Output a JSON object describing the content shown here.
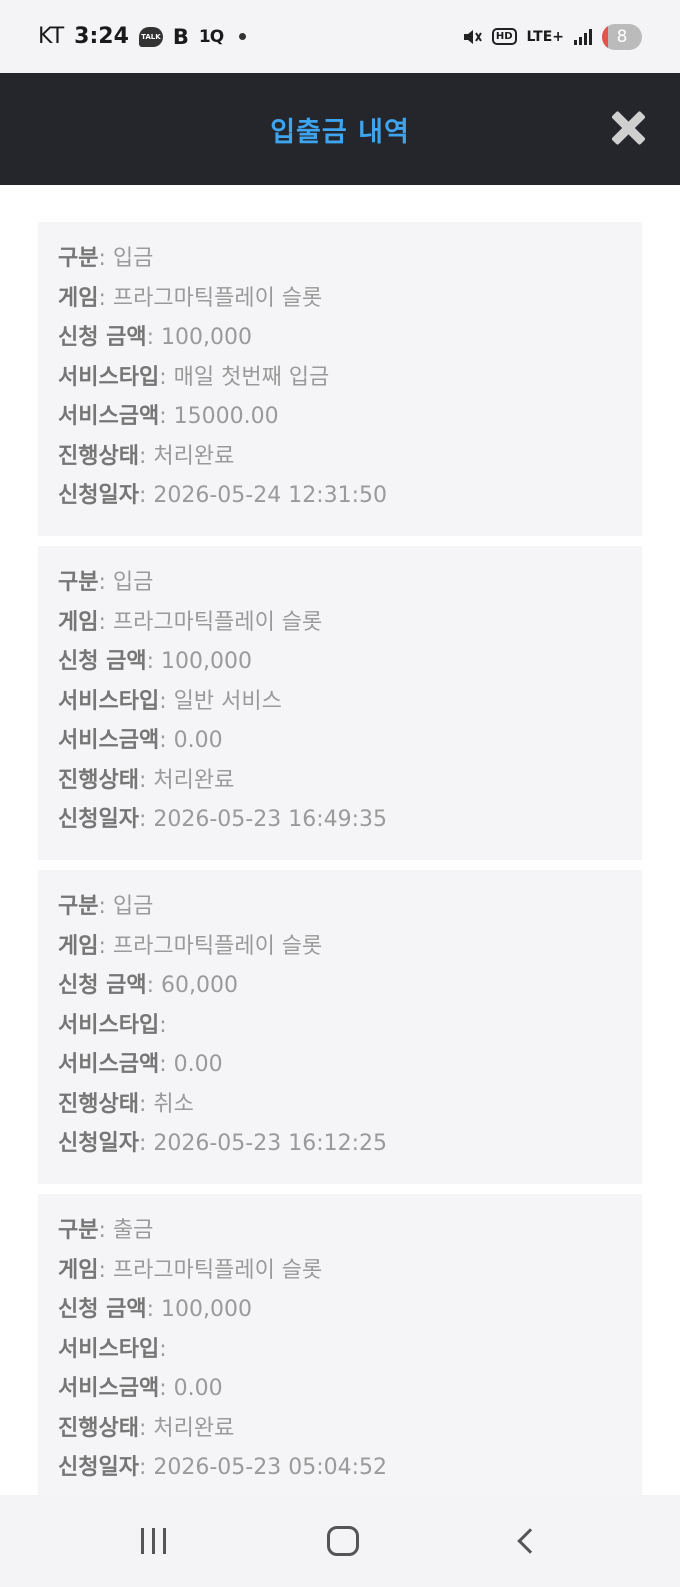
{
  "status_bar": {
    "carrier": "KT",
    "time": "3:24",
    "talk_label": "TALK",
    "b_label": "B",
    "q_label": "1Q",
    "hd_label": "HD",
    "network_label": "LTE+",
    "battery_level": "8"
  },
  "header": {
    "title": "입출금 내역"
  },
  "field_labels": {
    "type": "구분",
    "game": "게임",
    "amount": "신청 금액",
    "service_type": "서비스타입",
    "service_amount": "서비스금액",
    "status": "진행상태",
    "date": "신청일자"
  },
  "transactions": [
    {
      "type": "입금",
      "game": "프라그마틱플레이 슬롯",
      "amount": "100,000",
      "service_type": "매일 첫번째 입금",
      "service_amount": "15000.00",
      "status": "처리완료",
      "date": "2026-05-24 12:31:50"
    },
    {
      "type": "입금",
      "game": "프라그마틱플레이 슬롯",
      "amount": "100,000",
      "service_type": "일반 서비스",
      "service_amount": "0.00",
      "status": "처리완료",
      "date": "2026-05-23 16:49:35"
    },
    {
      "type": "입금",
      "game": "프라그마틱플레이 슬롯",
      "amount": "60,000",
      "service_type": "",
      "service_amount": "0.00",
      "status": "취소",
      "date": "2026-05-23 16:12:25"
    },
    {
      "type": "출금",
      "game": "프라그마틱플레이 슬롯",
      "amount": "100,000",
      "service_type": "",
      "service_amount": "0.00",
      "status": "처리완료",
      "date": "2026-05-23 05:04:52"
    }
  ],
  "colors": {
    "header_bg": "#24262b",
    "title_color": "#3ea4ee",
    "card_bg": "#f5f5f7"
  }
}
